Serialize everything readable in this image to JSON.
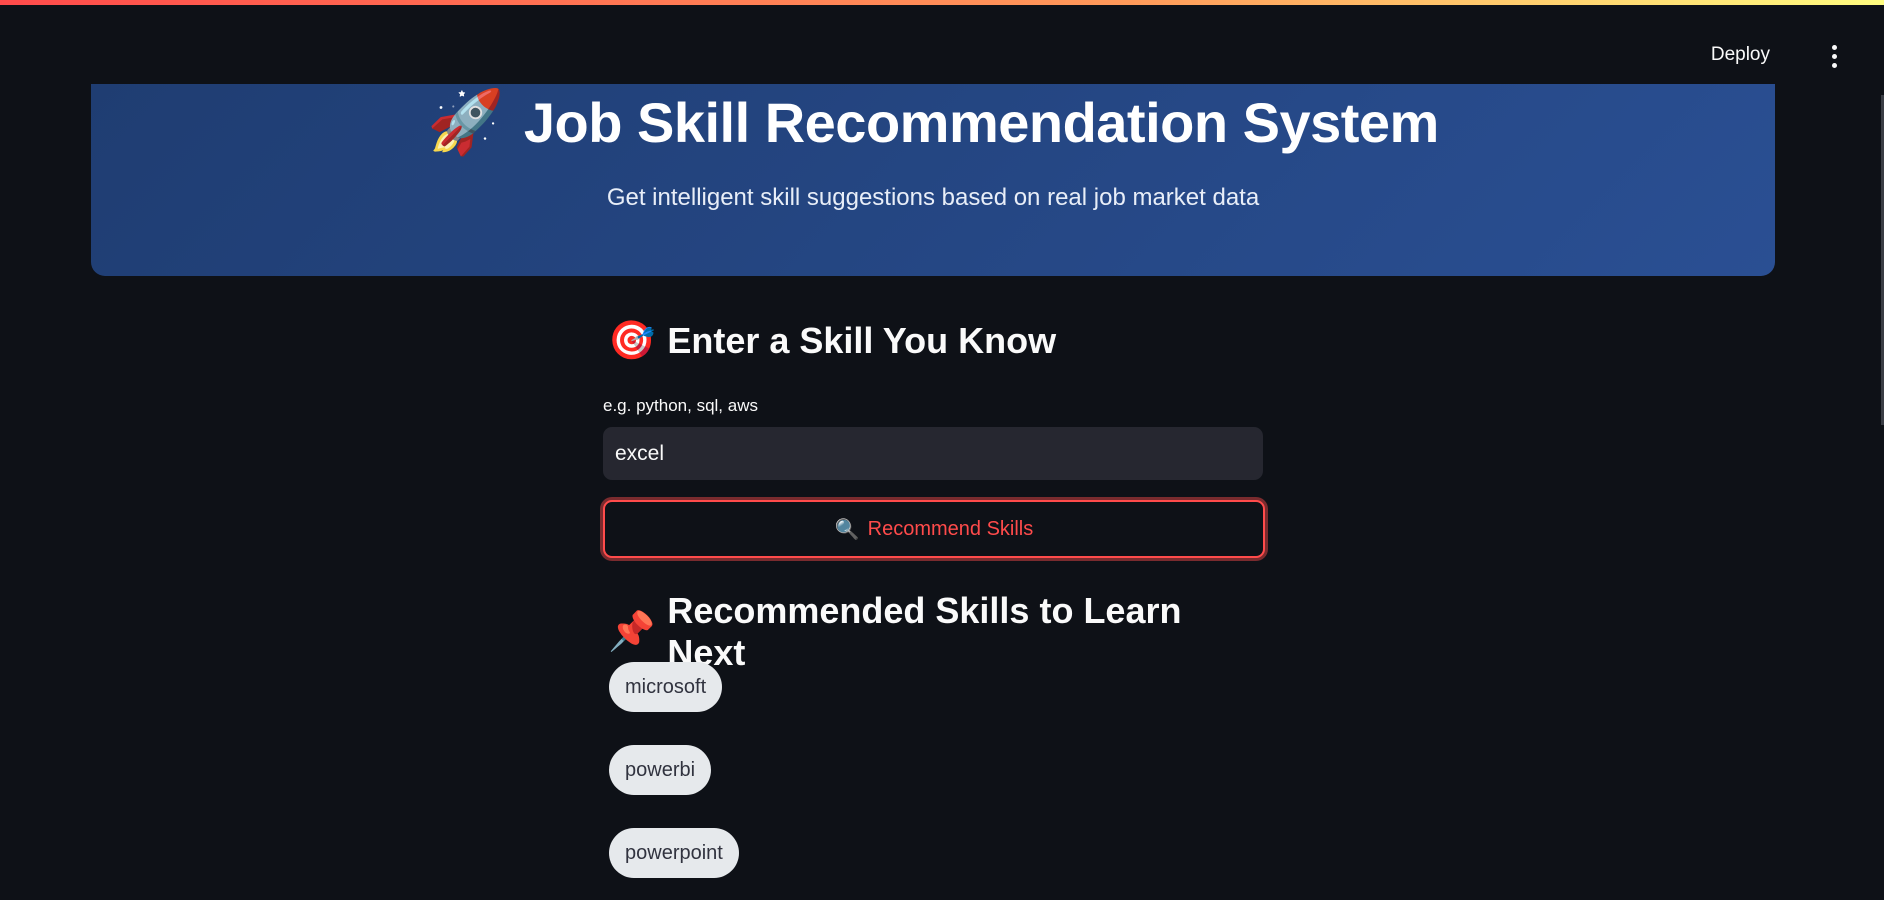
{
  "app": {
    "deploy_label": "Deploy",
    "menu_icon": "more-vertical-icon"
  },
  "hero": {
    "emoji": "🚀",
    "title": "Job Skill Recommendation System",
    "subtitle": "Get intelligent skill suggestions based on real job market data"
  },
  "input_section": {
    "emoji": "🎯",
    "heading": "Enter a Skill You Know",
    "label": "e.g. python, sql, aws",
    "value": "excel"
  },
  "button": {
    "icon": "🔍",
    "label": "Recommend Skills"
  },
  "results": {
    "emoji": "📌",
    "heading": "Recommended Skills to Learn Next",
    "skills": [
      "microsoft",
      "powerbi",
      "powerpoint"
    ]
  },
  "colors": {
    "background": "#0e1117",
    "hero_bg": "#2a4f93",
    "accent": "#ff4b4b",
    "input_bg": "#262730",
    "pill_bg": "#e6e9ec"
  }
}
